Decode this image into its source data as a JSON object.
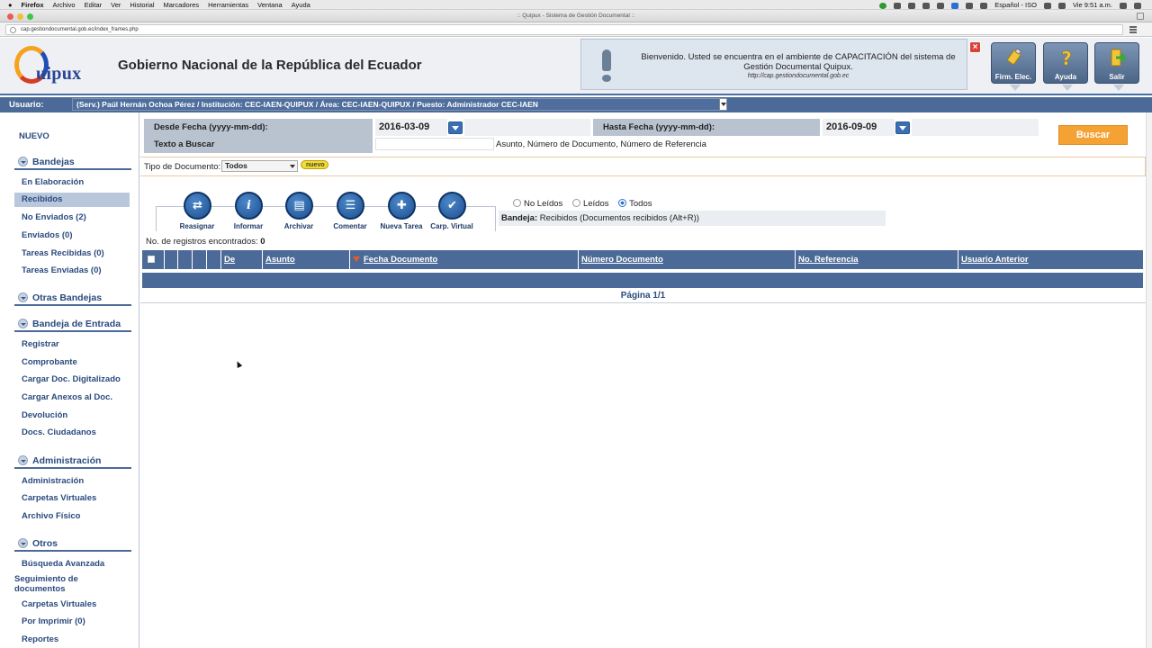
{
  "macbar": {
    "app": "Firefox",
    "menus": [
      "Archivo",
      "Editar",
      "Ver",
      "Historial",
      "Marcadores",
      "Herramientas",
      "Ventana",
      "Ayuda"
    ],
    "input_source": "Español - ISO",
    "clock": "Vie 9:51 a.m."
  },
  "window": {
    "title": ":: Quipux - Sistema de Gestión Documental ::"
  },
  "browser": {
    "url": "cap.gestiondocumental.gob.ec/index_frames.php"
  },
  "header": {
    "logo_text": "uipux",
    "title": "Gobierno Nacional de la República del Ecuador",
    "welcome_message": "Bienvenido. Usted se encuentra en el ambiente de CAPACITACIÓN del sistema de Gestión Documental Quipux.",
    "welcome_url": "http://cap.gestiondocumental.gob.ec",
    "close_label": "×",
    "buttons": {
      "firma": "Firm. Elec.",
      "ayuda": "Ayuda",
      "salir": "Salir"
    }
  },
  "userbar": {
    "label": "Usuario:",
    "value": "(Serv.) Paúl Hernán Ochoa Pérez / Institución: CEC-IAEN-QUIPUX / Área: CEC-IAEN-QUIPUX / Puesto: Administrador CEC-IAEN"
  },
  "sidebar": {
    "nuevo": "NUEVO",
    "sections": {
      "bandejas": "Bandejas",
      "otras": "Otras Bandejas",
      "entrada": "Bandeja de Entrada",
      "admin": "Administración",
      "otros": "Otros"
    },
    "bandejas": [
      "En Elaboración",
      "Recibidos",
      "No Enviados (2)",
      "Enviados (0)",
      "Tareas Recibidas (0)",
      "Tareas Enviadas (0)"
    ],
    "entrada": [
      "Registrar",
      "Comprobante",
      "Cargar Doc. Digitalizado",
      "Cargar Anexos al Doc.",
      "Devolución",
      "Docs. Ciudadanos"
    ],
    "admin": [
      "Administración",
      "Carpetas Virtuales",
      "Archivo Físico"
    ],
    "otros": [
      "Búsqueda Avanzada",
      "Seguimiento de documentos",
      "Carpetas Virtuales",
      "Por Imprimir (0)",
      "Reportes"
    ]
  },
  "search": {
    "desde_label": "Desde Fecha (yyyy-mm-dd):",
    "desde_value": "2016-03-09",
    "hasta_label": "Hasta Fecha (yyyy-mm-dd):",
    "hasta_value": "2016-09-09",
    "texto_label": "Texto a Buscar",
    "texto_value": "",
    "texto_hint": "Asunto, Número de Documento, Número de Referencia",
    "buscar": "Buscar",
    "tipo_label": "Tipo de Documento:",
    "tipo_value": "Todos",
    "nuevo_badge": "nuevo"
  },
  "toolbar": {
    "reasignar": "Reasignar",
    "informar": "Informar",
    "archivar": "Archivar",
    "comentar": "Comentar",
    "nueva_tarea": "Nueva Tarea",
    "carp_virtual": "Carp. Virtual"
  },
  "filters": {
    "no_leidos": "No Leídos",
    "leidos": "Leídos",
    "todos": "Todos",
    "selected": "Todos"
  },
  "bandeja": {
    "label": "Bandeja:",
    "value": "Recibidos (Documentos recibidos (Alt+R))"
  },
  "results": {
    "label": "No. de registros encontrados:",
    "count": "0"
  },
  "table": {
    "columns": [
      "De",
      "Asunto",
      "Fecha Documento",
      "Número Documento",
      "No. Referencia",
      "Usuario Anterior"
    ]
  },
  "pagination": {
    "text": "Página 1/1"
  }
}
